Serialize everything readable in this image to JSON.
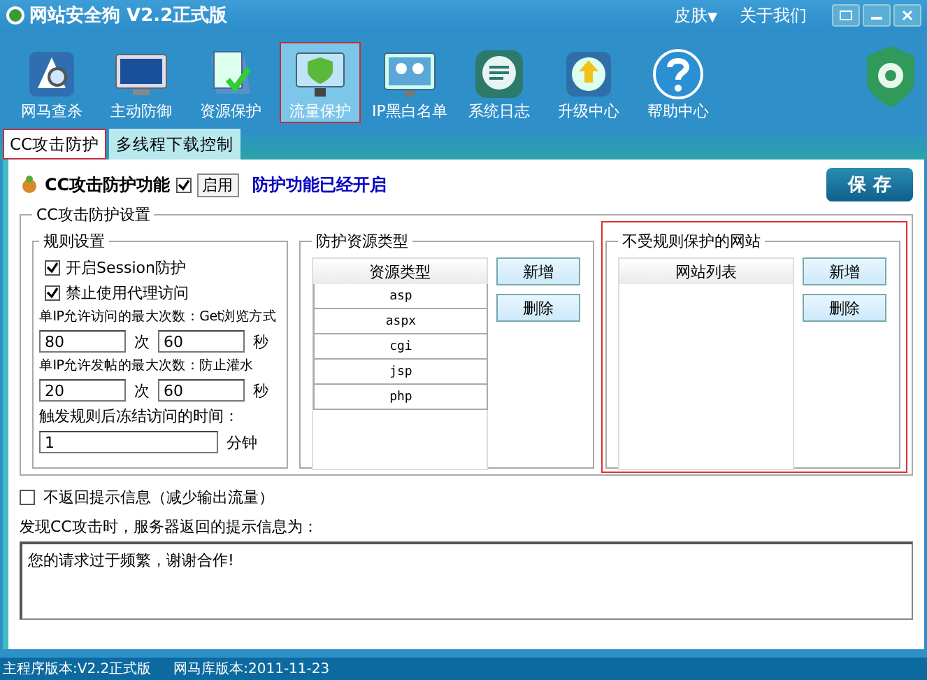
{
  "window": {
    "title": "网站安全狗 V2.2正式版",
    "menu": [
      {
        "label": "皮肤",
        "caret": "▼"
      },
      {
        "label": "关于我们"
      }
    ]
  },
  "toolbar": [
    {
      "label": "网马查杀",
      "selected": false
    },
    {
      "label": "主动防御",
      "selected": false
    },
    {
      "label": "资源保护",
      "selected": false
    },
    {
      "label": "流量保护",
      "selected": true
    },
    {
      "label": "IP黑白名单",
      "selected": false
    },
    {
      "label": "系统日志",
      "selected": false
    },
    {
      "label": "升级中心",
      "selected": false
    },
    {
      "label": "帮助中心",
      "selected": false
    }
  ],
  "tabs": [
    {
      "label": "CC攻击防护",
      "selected": true
    },
    {
      "label": "多线程下载控制",
      "selected": false
    }
  ],
  "feature": {
    "label": "CC攻击防护功能",
    "checked": true,
    "button": "启用",
    "status": "防护功能已经开启"
  },
  "save_button": "保 存",
  "settings": {
    "title": "CC攻击防护设置",
    "rules": {
      "title": "规则设置",
      "checkboxes": [
        {
          "label": "开启Session防护",
          "checked": true
        },
        {
          "label": "禁止使用代理访问",
          "checked": true
        }
      ],
      "get_limit": {
        "label": "单IP允许访问的最大次数：Get浏览方式",
        "count": "80",
        "count_unit": "次",
        "seconds": "60",
        "seconds_unit": "秒"
      },
      "post_limit": {
        "label": "单IP允许发帖的最大次数：防止灌水",
        "count": "20",
        "count_unit": "次",
        "seconds": "60",
        "seconds_unit": "秒"
      },
      "freeze": {
        "label": "触发规则后冻结访问的时间：",
        "value": "1",
        "unit": "分钟"
      }
    },
    "resources": {
      "title": "防护资源类型",
      "column": "资源类型",
      "rows": [
        "asp",
        "aspx",
        "cgi",
        "jsp",
        "php"
      ],
      "buttons": [
        "新增",
        "删除"
      ]
    },
    "sites": {
      "title": "不受规则保护的网站",
      "column": "网站列表",
      "buttons": [
        "新增",
        "删除"
      ]
    }
  },
  "no_reply": {
    "label": "不返回提示信息（减少输出流量）",
    "checked": false
  },
  "message": {
    "label": "发现CC攻击时，服务器返回的提示信息为：",
    "value": "您的请求过于频繁，谢谢合作!"
  },
  "status_bar": [
    "主程序版本:V2.2正式版",
    "网马库版本:2011-11-23"
  ]
}
